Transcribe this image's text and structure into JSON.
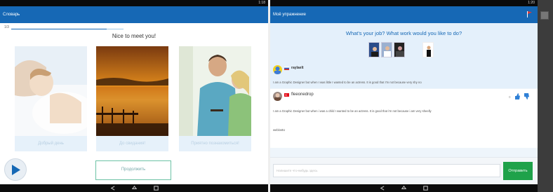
{
  "left": {
    "status_time": "1:18",
    "title": "Словарь",
    "progress_label": "1/3",
    "progress_fraction": 0.85,
    "greeting": "Nice to meet you!",
    "cards": [
      {
        "caption": "Добрый день",
        "image": "sleeping-woman"
      },
      {
        "caption": "До свидания!",
        "image": "sunset-pier"
      },
      {
        "caption": "Приятно познакомиться!",
        "image": "smiling-couple"
      }
    ],
    "continue_label": "Продолжить"
  },
  "right": {
    "status_time": "1:20",
    "title": "Моё упражнение",
    "question": "What's your job? What work would you like to do?",
    "messages": [
      {
        "user": "raylaelt",
        "text": "I am a Graphic Designer but when I was little I wanted to be an actress. It is good that I'm not because very shy no"
      },
      {
        "user": "fleeonedrop",
        "text": "I am a Graphic Designer but when i was a child I wanted to be an actress. It is good that i'm not because i am very sheelly",
        "extra": "weblostU",
        "count": "0"
      }
    ],
    "input_placeholder": "Напишите что-нибудь здесь",
    "send_label": "Отправить"
  },
  "colors": {
    "appbar": "#1668b5",
    "send": "#1fa24a",
    "continue_border": "#6cc2a5"
  }
}
